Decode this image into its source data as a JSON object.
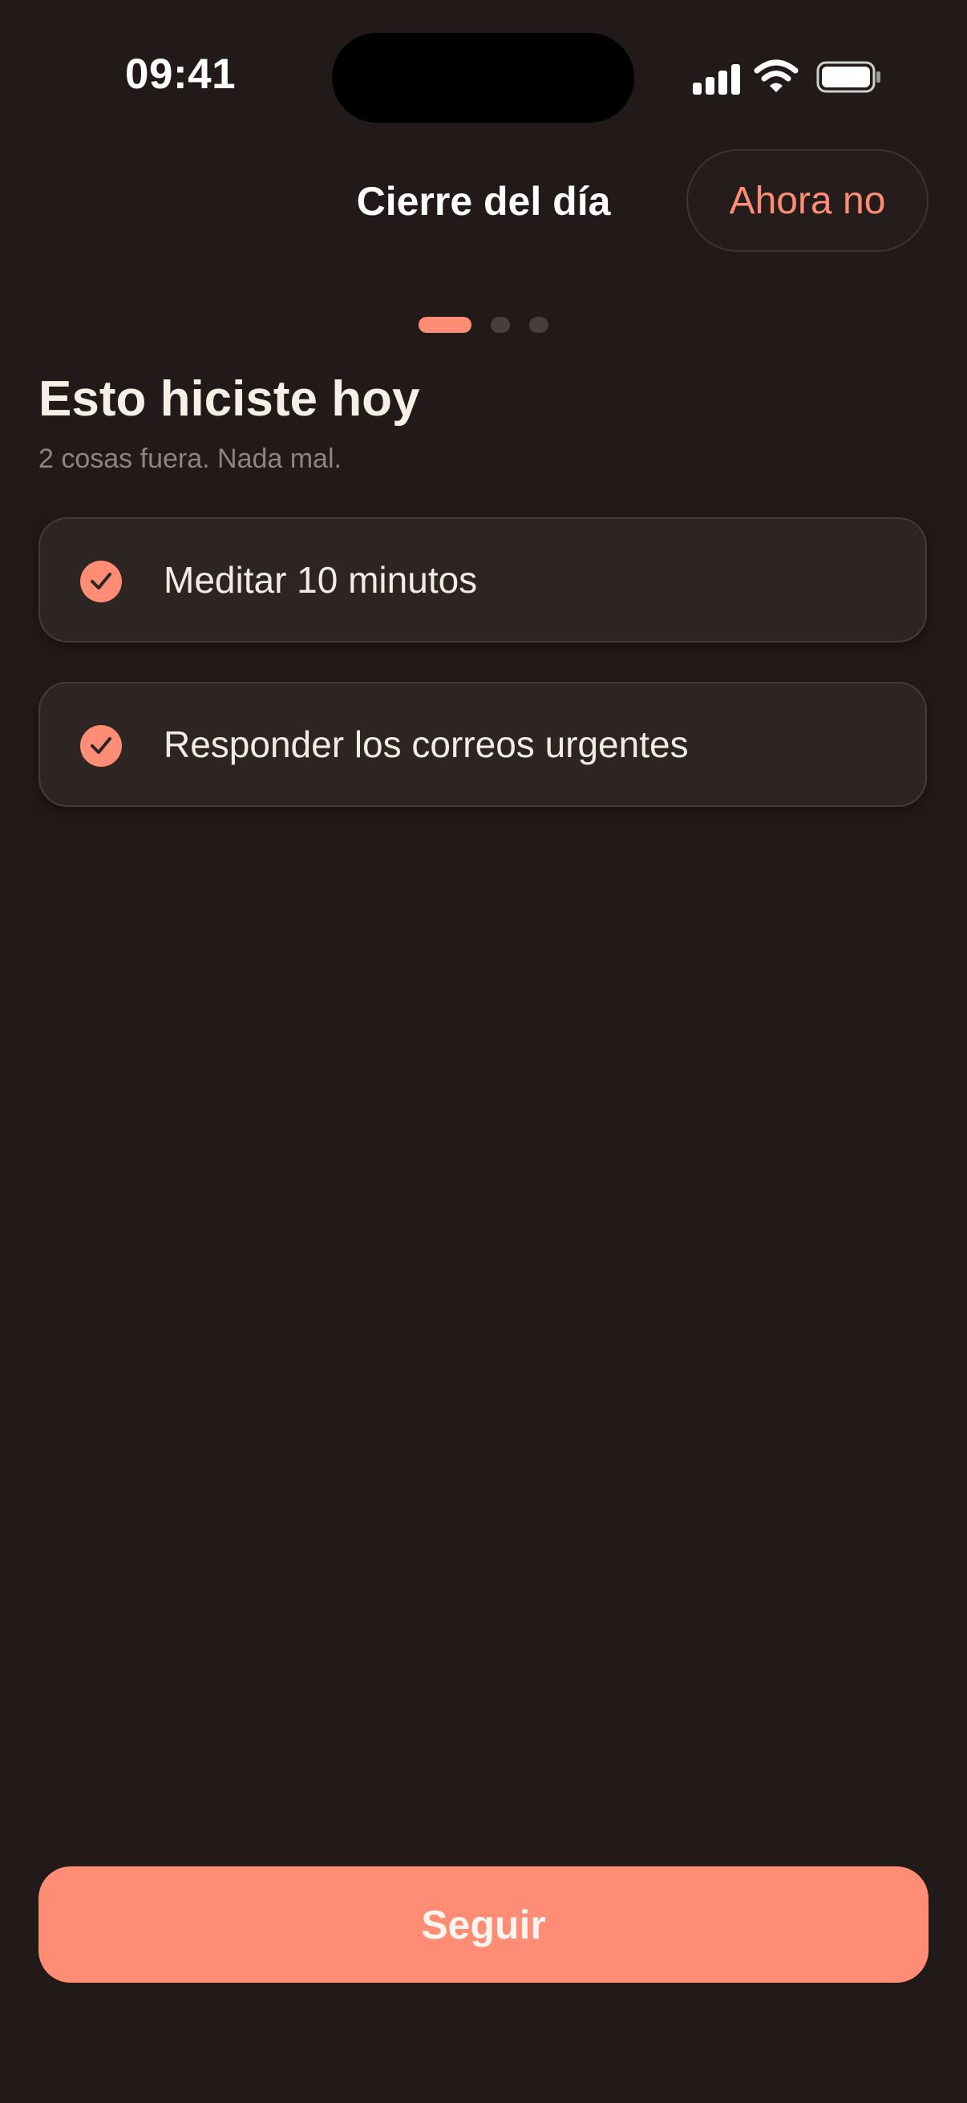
{
  "status_bar": {
    "time": "09:41",
    "icons": [
      "signal-icon",
      "wifi-icon",
      "battery-icon"
    ]
  },
  "header": {
    "title": "Cierre del día",
    "skip_label": "Ahora no"
  },
  "pager": {
    "total_steps": 3,
    "current_step": 1
  },
  "step": {
    "title": "Esto hiciste hoy",
    "subtitle": "2 cosas fuera. Nada mal."
  },
  "tasks": [
    {
      "label": "Meditar 10 minutos",
      "completed": true
    },
    {
      "label": "Responder los correos urgentes",
      "completed": true
    }
  ],
  "footer": {
    "continue_label": "Seguir"
  },
  "colors": {
    "background": "#211a18",
    "accent": "#ff8d76",
    "card": "#2c2521",
    "muted_text": "#8d8580"
  }
}
